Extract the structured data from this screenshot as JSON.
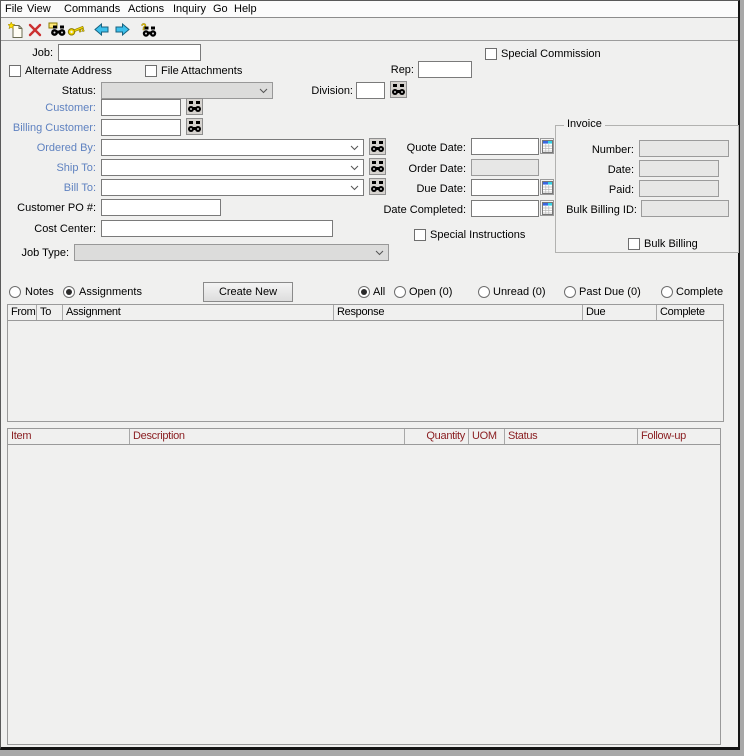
{
  "menu_bar": {
    "items": [
      "File",
      "View",
      "Commands",
      "Actions",
      "Inquiry",
      "Go",
      "Help"
    ]
  },
  "toolbar": {
    "icons": [
      "new-record-icon",
      "delete-icon",
      "find-record-icon",
      "key-icon",
      "back-icon",
      "forward-icon",
      "search-help-icon"
    ]
  },
  "form": {
    "job_label": "Job:",
    "job_value": "",
    "special_commission_label": "Special Commission",
    "alternate_address_label": "Alternate Address",
    "file_attachments_label": "File Attachments",
    "rep_label": "Rep:",
    "rep_value": "",
    "status_label": "Status:",
    "status_value": "",
    "division_label": "Division:",
    "division_value": "",
    "customer_label": "Customer:",
    "customer_value": "",
    "billing_customer_label": "Billing Customer:",
    "billing_customer_value": "",
    "ordered_by_label": "Ordered By:",
    "ordered_by_value": "",
    "ship_to_label": "Ship To:",
    "ship_to_value": "",
    "bill_to_label": "Bill To:",
    "bill_to_value": "",
    "customer_po_label": "Customer PO #:",
    "customer_po_value": "",
    "cost_center_label": "Cost Center:",
    "cost_center_value": "",
    "job_type_label": "Job Type:",
    "job_type_value": "",
    "quote_date_label": "Quote Date:",
    "quote_date_value": "",
    "order_date_label": "Order Date:",
    "order_date_value": "",
    "due_date_label": "Due Date:",
    "due_date_value": "",
    "date_completed_label": "Date Completed:",
    "date_completed_value": "",
    "special_instructions_label": "Special Instructions"
  },
  "invoice": {
    "title": "Invoice",
    "number_label": "Number:",
    "number_value": "",
    "date_label": "Date:",
    "date_value": "",
    "paid_label": "Paid:",
    "paid_value": "",
    "bulk_billing_id_label": "Bulk Billing ID:",
    "bulk_billing_id_value": "",
    "bulk_billing_label": "Bulk Billing"
  },
  "panel": {
    "notes_label": "Notes",
    "assignments_label": "Assignments",
    "selected_view": "Assignments",
    "create_new_label": "Create New",
    "selected_filter": "All",
    "filters": [
      {
        "label": "All",
        "selected": true
      },
      {
        "label": "Open (0)",
        "selected": false
      },
      {
        "label": "Unread (0)",
        "selected": false
      },
      {
        "label": "Past Due (0)",
        "selected": false
      },
      {
        "label": "Complete",
        "selected": false
      }
    ]
  },
  "assignments_table": {
    "columns": [
      "From",
      "To",
      "Assignment",
      "Response",
      "Due",
      "Complete"
    ],
    "rows": []
  },
  "items_table": {
    "columns": [
      "Item",
      "Description",
      "Quantity",
      "UOM",
      "Status",
      "Follow-up"
    ],
    "rows": []
  },
  "colors": {
    "link_blue": "#5f82c0",
    "items_header_text": "#8b2023",
    "window_bg": "#f0f0ef"
  }
}
